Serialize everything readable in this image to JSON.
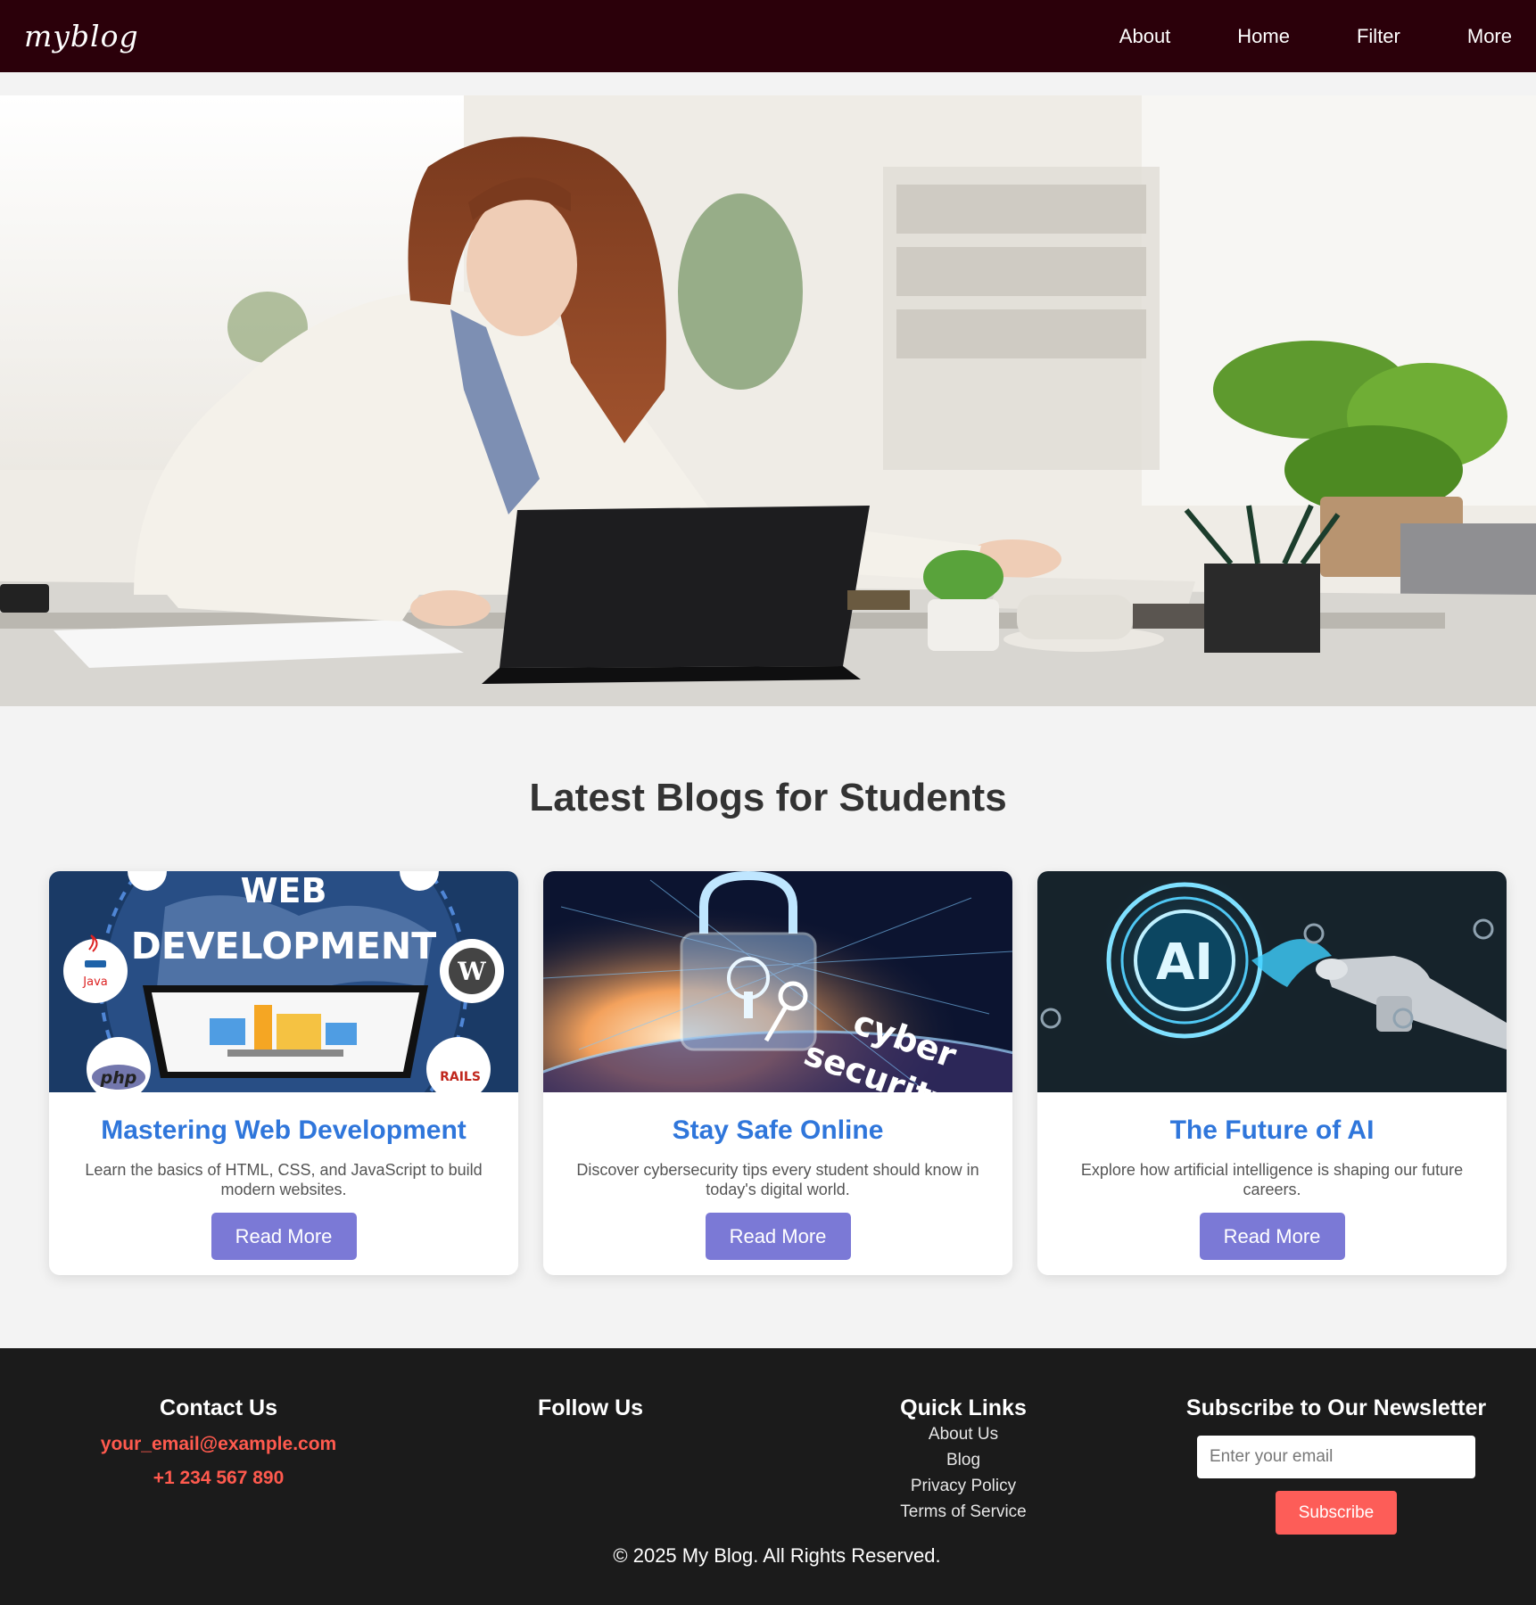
{
  "nav": {
    "logo": "myblog",
    "links": [
      "About",
      "Home",
      "Filter",
      "More"
    ]
  },
  "hero": {
    "image": "woman-working-on-laptop-at-desk-photo"
  },
  "blogs": {
    "title": "Latest Blogs for Students",
    "cards": [
      {
        "image": "web-development-banner",
        "image_text": [
          "WEB",
          "DEVELOPMENT"
        ],
        "badges": [
          "Java",
          "php",
          "RAILS"
        ],
        "title": "Mastering Web Development",
        "description": "Learn the basics of HTML, CSS, and JavaScript to build modern websites.",
        "button": "Read More"
      },
      {
        "image": "cyber-security-padlock-banner",
        "image_text": [
          "cyber",
          "security"
        ],
        "title": "Stay Safe Online",
        "description": "Discover cybersecurity tips every student should know in today's digital world.",
        "button": "Read More"
      },
      {
        "image": "ai-robot-hand-banner",
        "image_text": [
          "AI"
        ],
        "title": "The Future of AI",
        "description": "Explore how artificial intelligence is shaping our future careers.",
        "button": "Read More"
      }
    ]
  },
  "footer": {
    "contact": {
      "title": "Contact Us",
      "email": "your_email@example.com",
      "phone": "+1 234 567 890"
    },
    "follow": {
      "title": "Follow Us"
    },
    "quick_links": {
      "title": "Quick Links",
      "links": [
        "About Us",
        "Blog",
        "Privacy Policy",
        "Terms of Service"
      ]
    },
    "newsletter": {
      "title": "Subscribe to Our Newsletter",
      "placeholder": "Enter your email",
      "button": "Subscribe"
    },
    "copyright": "© 2025 My Blog. All Rights Reserved."
  },
  "colors": {
    "nav_bg": "#2b000a",
    "card_title": "#2f76db",
    "button": "#7b79d6",
    "footer_bg": "#1b1b1b",
    "contact_link": "#ff5a4e",
    "subscribe": "#fd5d58"
  }
}
